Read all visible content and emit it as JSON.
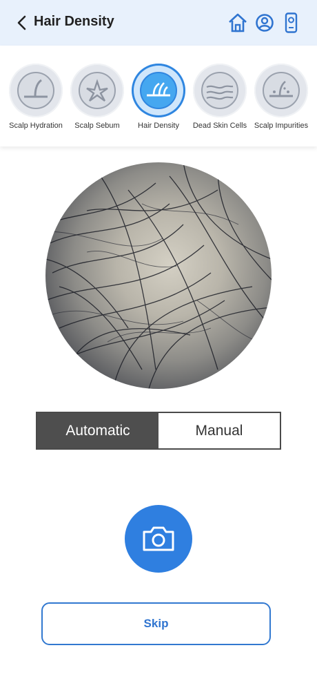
{
  "header": {
    "title": "Hair Density"
  },
  "colors": {
    "accent": "#2f7fe0",
    "header_bg": "#e8f1fc",
    "toggle_active": "#4e4e4e"
  },
  "categories": [
    {
      "label": "Scalp Hydration",
      "icon": "scalp-hydration-icon",
      "active": false
    },
    {
      "label": "Scalp Sebum",
      "icon": "scalp-sebum-icon",
      "active": false
    },
    {
      "label": "Hair Density",
      "icon": "hair-density-icon",
      "active": true
    },
    {
      "label": "Dead Skin Cells",
      "icon": "dead-skin-cells-icon",
      "active": false
    },
    {
      "label": "Scalp Impurities",
      "icon": "scalp-impurities-icon",
      "active": false
    }
  ],
  "mode": {
    "automatic": "Automatic",
    "manual": "Manual",
    "selected": "Automatic"
  },
  "actions": {
    "skip": "Skip"
  }
}
